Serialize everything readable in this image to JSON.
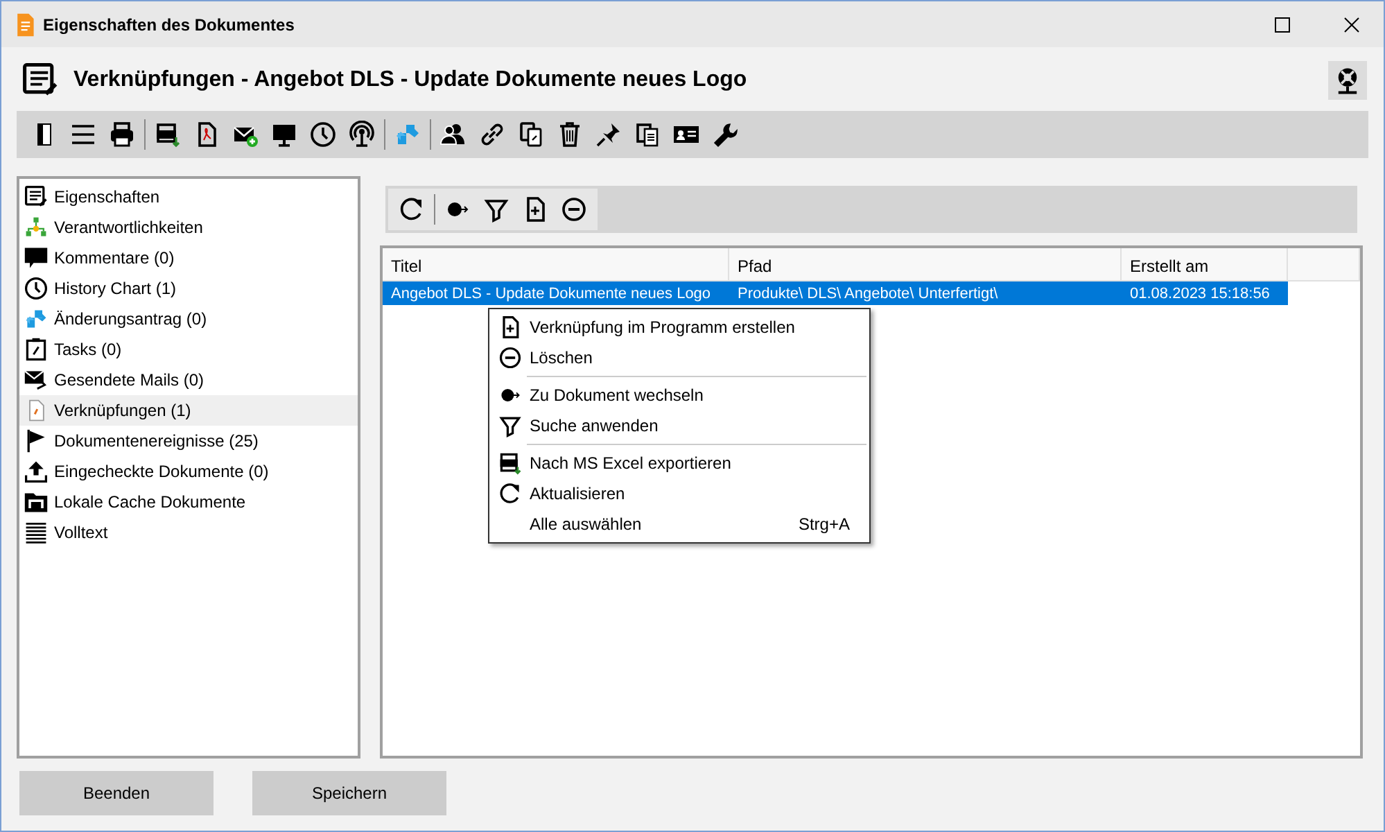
{
  "window": {
    "title": "Eigenschaften des Dokumentes"
  },
  "header": {
    "title": "Verknüpfungen - Angebot DLS - Update Dokumente neues Logo"
  },
  "sidebar": {
    "items": [
      {
        "label": "Eigenschaften",
        "selected": false
      },
      {
        "label": "Verantwortlichkeiten",
        "selected": false
      },
      {
        "label": "Kommentare (0)",
        "selected": false
      },
      {
        "label": "History Chart (1)",
        "selected": false
      },
      {
        "label": "Änderungsantrag (0)",
        "selected": false
      },
      {
        "label": "Tasks (0)",
        "selected": false
      },
      {
        "label": "Gesendete Mails (0)",
        "selected": false
      },
      {
        "label": "Verknüpfungen (1)",
        "selected": true
      },
      {
        "label": "Dokumentenereignisse (25)",
        "selected": false
      },
      {
        "label": "Eingecheckte Dokumente (0)",
        "selected": false
      },
      {
        "label": "Lokale Cache Dokumente",
        "selected": false
      },
      {
        "label": "Volltext",
        "selected": false
      }
    ]
  },
  "table": {
    "columns": [
      "Titel",
      "Pfad",
      "Erstellt am"
    ],
    "rows": [
      {
        "cells": [
          "Angebot DLS - Update Dokumente neues Logo",
          "Produkte\\ DLS\\ Angebote\\ Unterfertigt\\",
          "01.08.2023 15:18:56"
        ],
        "selected": true
      }
    ]
  },
  "context_menu": {
    "items": [
      {
        "kind": "item",
        "label": "Verknüpfung im Programm erstellen"
      },
      {
        "kind": "item",
        "label": "Löschen"
      },
      {
        "kind": "separator"
      },
      {
        "kind": "item",
        "label": "Zu Dokument wechseln"
      },
      {
        "kind": "item",
        "label": "Suche anwenden"
      },
      {
        "kind": "separator"
      },
      {
        "kind": "item",
        "label": "Nach MS Excel exportieren"
      },
      {
        "kind": "item",
        "label": "Aktualisieren"
      },
      {
        "kind": "item",
        "label": "Alle auswählen",
        "shortcut": "Strg+A"
      }
    ]
  },
  "buttons": [
    "Beenden",
    "Speichern"
  ]
}
